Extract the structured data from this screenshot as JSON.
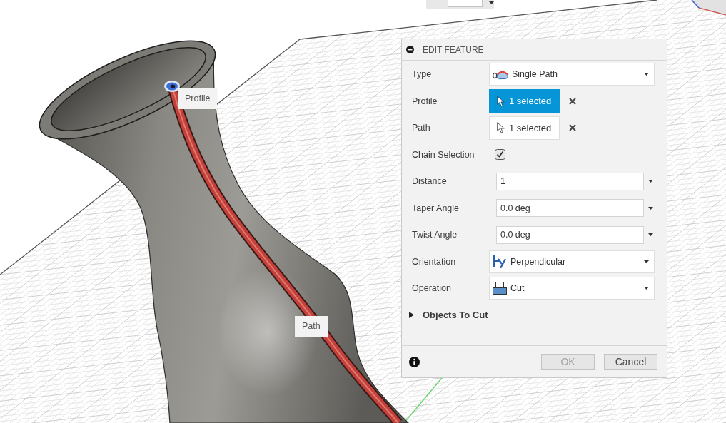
{
  "viewport": {
    "callouts": [
      {
        "text": "Profile"
      },
      {
        "text": "Path"
      }
    ]
  },
  "dialog": {
    "title": "EDIT FEATURE",
    "rows": [
      {
        "kind": "dropdown",
        "label": "Type",
        "value": "Single Path"
      },
      {
        "kind": "selection",
        "label": "Profile",
        "value": "1 selected",
        "selected": true
      },
      {
        "kind": "selection",
        "label": "Path",
        "value": "1 selected",
        "selected": false
      },
      {
        "kind": "checkbox",
        "label": "Chain Selection",
        "checked": true
      },
      {
        "kind": "input",
        "label": "Distance",
        "value": "1"
      },
      {
        "kind": "input",
        "label": "Taper Angle",
        "value": "0.0 deg"
      },
      {
        "kind": "input",
        "label": "Twist Angle",
        "value": "0.0 deg"
      },
      {
        "kind": "dropdown",
        "label": "Orientation",
        "value": "Perpendicular"
      },
      {
        "kind": "dropdown",
        "label": "Operation",
        "value": "Cut"
      }
    ],
    "section": {
      "label": "Objects To Cut",
      "expanded": false
    },
    "buttons": [
      {
        "label": "OK",
        "disabled": true
      },
      {
        "label": "Cancel",
        "disabled": false
      }
    ]
  }
}
